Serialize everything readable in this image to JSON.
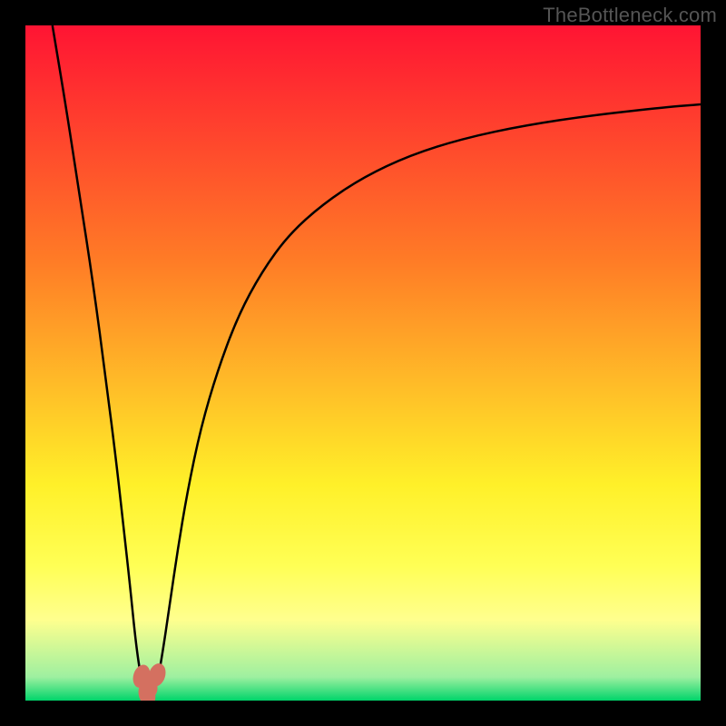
{
  "watermark": "TheBottleneck.com",
  "colors": {
    "bg": "#000000",
    "grad_red": "#ff1433",
    "grad_orange": "#ff7c26",
    "grad_yellow": "#fff029",
    "grad_paleyellow": "#ffff8e",
    "grad_green": "#1ee079",
    "grad_green2": "#00d46a",
    "curve": "#000000",
    "marker": "#d47060"
  },
  "chart_data": {
    "type": "line",
    "title": "",
    "xlabel": "",
    "ylabel": "",
    "xlim": [
      0,
      100
    ],
    "ylim": [
      0,
      100
    ],
    "x": [
      4,
      6,
      8,
      10,
      12,
      13.5,
      14.5,
      15.5,
      16.3,
      17,
      17.6,
      18.1,
      18.5,
      19,
      19.6,
      20.3,
      21.2,
      22.5,
      24,
      26,
      28.5,
      31.5,
      35,
      39,
      44,
      50,
      57,
      65,
      74,
      84,
      95,
      100
    ],
    "y": [
      100,
      88,
      75,
      62,
      47,
      35,
      26,
      17,
      9,
      4,
      1.5,
      0.6,
      0.5,
      1,
      3,
      7,
      13,
      22,
      31,
      40.5,
      49,
      57,
      63.5,
      69,
      73.5,
      77.5,
      80.8,
      83.3,
      85.2,
      86.7,
      87.9,
      88.3
    ],
    "markers": {
      "x": [
        17.2,
        18.0,
        19.5,
        18.3
      ],
      "y": [
        3.6,
        0.9,
        3.8,
        2.2
      ]
    },
    "note_gradient_bands_pct_from_top": {
      "red_to_orange": 35,
      "orange_to_yellow": 68,
      "yellow_to_paleyellow": 80,
      "paleyellow_to_green": 96.5
    }
  }
}
